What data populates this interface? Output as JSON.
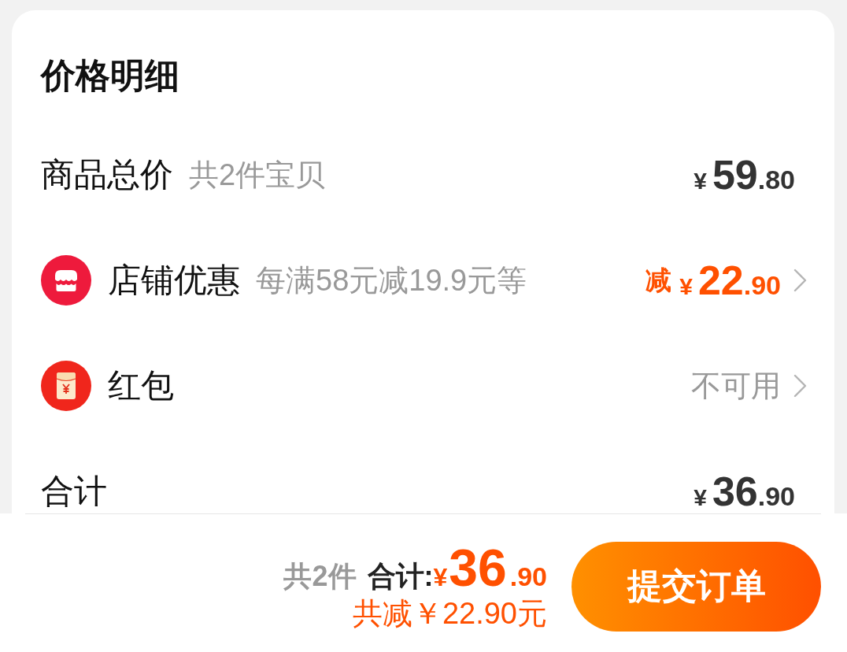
{
  "price_details": {
    "title": "价格明细",
    "rows": [
      {
        "kind": "subtotal",
        "label": "商品总价",
        "note": "共2件宝贝",
        "amount": {
          "currency": "¥",
          "integer": "59",
          "decimal": ".80"
        },
        "arrow": false
      },
      {
        "kind": "shop_discount",
        "label": "店铺优惠",
        "note": "每满58元减19.9元等",
        "prefix": "减",
        "amount": {
          "currency": "¥",
          "integer": "22",
          "decimal": ".90"
        },
        "arrow": true
      },
      {
        "kind": "red_packet",
        "label": "红包",
        "status": "不可用",
        "arrow": true
      },
      {
        "kind": "total",
        "label": "合计",
        "amount": {
          "currency": "¥",
          "integer": "36",
          "decimal": ".90"
        },
        "arrow": false
      }
    ]
  },
  "checkout_bar": {
    "item_count": "共2件",
    "total_label": "合计:",
    "total": {
      "currency": "¥",
      "integer": "36",
      "decimal": ".90"
    },
    "savings": "共减￥22.90元",
    "submit_button": "提交订单"
  }
}
